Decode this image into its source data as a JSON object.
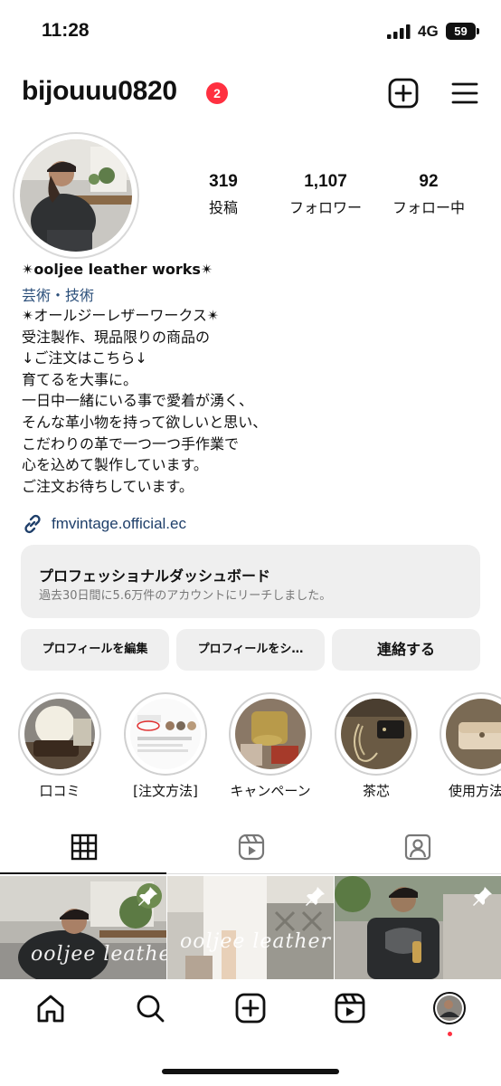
{
  "status_bar": {
    "time": "11:28",
    "network": "4G",
    "battery": "59"
  },
  "header": {
    "username": "bijouuu0820",
    "notification_count": "2"
  },
  "stats": [
    {
      "value": "319",
      "label": "投稿"
    },
    {
      "value": "1,107",
      "label": "フォロワー"
    },
    {
      "value": "92",
      "label": "フォロー中"
    }
  ],
  "bio": {
    "name": "✴︎ooljee leather works✴︎",
    "category": "芸術・技術",
    "lines": [
      "✴︎オールジーレザーワークス✴︎",
      "受注製作、現品限りの商品の",
      "↓ご注文はこちら↓",
      "育てるを大事に。",
      "一日中一緒にいる事で愛着が湧く、",
      "そんな革小物を持って欲しいと思い、",
      "こだわりの革で一つ一つ手作業で",
      "心を込めて製作しています。",
      "ご注文お待ちしています。"
    ],
    "link": "fmvintage.official.ec"
  },
  "dashboard": {
    "title": "プロフェッショナルダッシュボード",
    "subtitle": "過去30日間に5.6万件のアカウントにリーチしました。"
  },
  "buttons": {
    "edit_profile": "プロフィールを編集",
    "share_profile": "プロフィールをシ…",
    "contact": "連絡する"
  },
  "highlights": [
    {
      "label": "口コミ"
    },
    {
      "label": "[注文方法]"
    },
    {
      "label": "キャンペーン"
    },
    {
      "label": "茶芯"
    },
    {
      "label": "使用方法"
    }
  ],
  "posts": [
    {
      "watermark": "ooljee leather",
      "pinned": true
    },
    {
      "watermark": "ooljee leather",
      "pinned": true
    },
    {
      "watermark": "",
      "pinned": true
    }
  ],
  "colors": {
    "accent_red": "#ff3040",
    "link_blue": "#1f3f6a",
    "button_gray": "#efefef"
  }
}
